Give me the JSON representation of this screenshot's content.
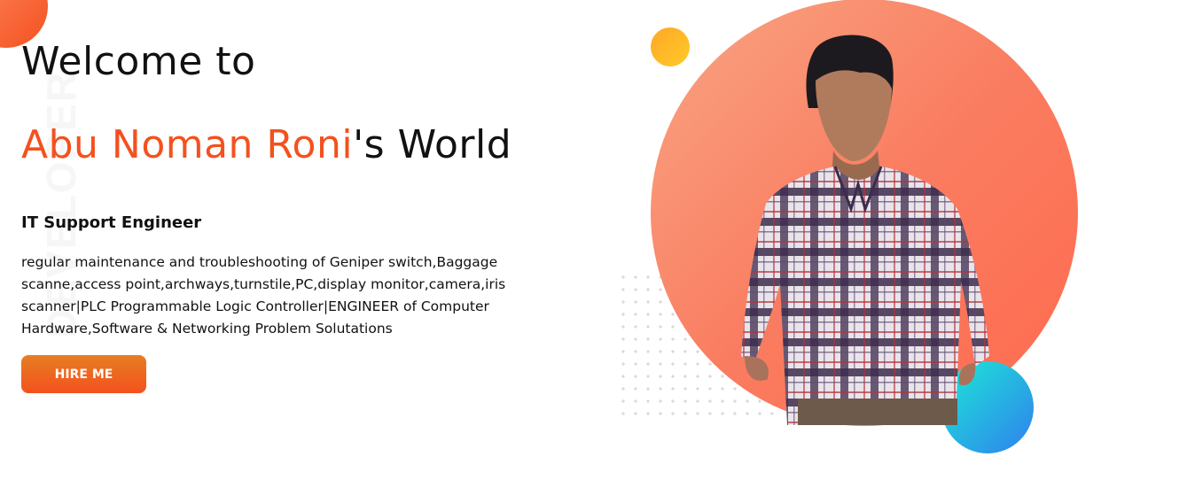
{
  "hero": {
    "welcome_text": "Welcome to",
    "name": "Abu Noman Roni",
    "name_suffix": "'s World",
    "role": "IT Support Engineer",
    "description": "regular maintenance and troubleshooting of Geniper switch,Baggage scanne,access point,archways,turnstile,PC,display monitor,camera,iris scanner|PLC Programmable Logic Controller|ENGINEER of Computer Hardware,Software & Networking Problem Solutations",
    "hire_button_label": "HIRE ME",
    "background_word": "DEVELOPER"
  },
  "colors": {
    "accent": "#f4511e",
    "circle_gradient": [
      "#f8a583",
      "#ff6a4e"
    ],
    "yellow_dot": "#ffb300",
    "blue_dot": [
      "#1de9d6",
      "#2f80ed"
    ]
  },
  "icons": {
    "portrait": "person-portrait-image"
  }
}
